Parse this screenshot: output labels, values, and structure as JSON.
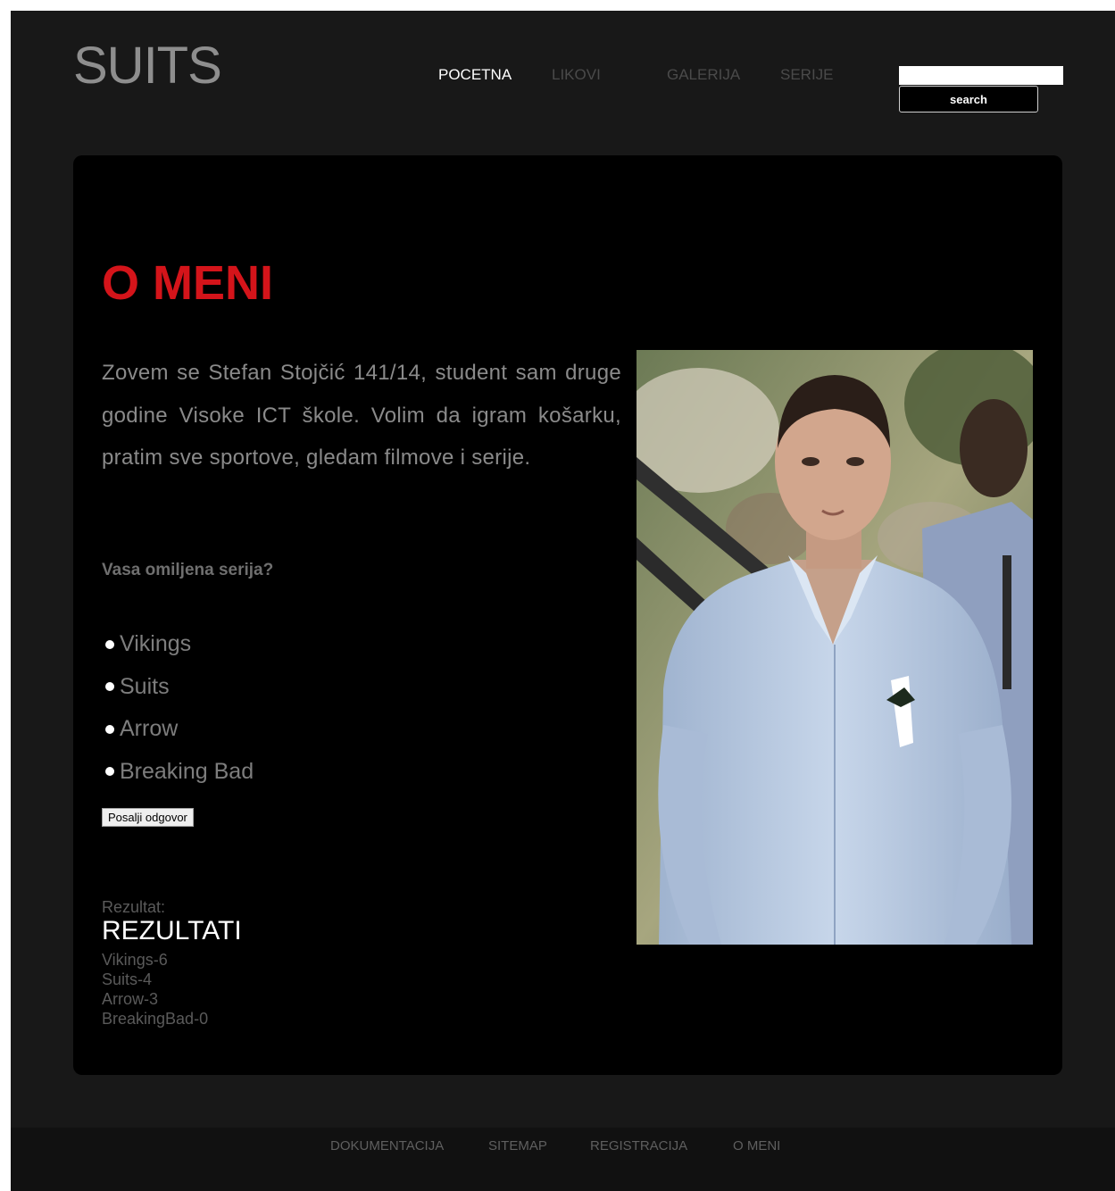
{
  "header": {
    "logo": "SUITS",
    "nav": [
      {
        "label": "POCETNA",
        "active": true
      },
      {
        "label": "LIKOVI",
        "active": false
      },
      {
        "label": "GALERIJA",
        "active": false
      },
      {
        "label": "SERIJE",
        "active": false
      }
    ],
    "search": {
      "value": "",
      "placeholder": "",
      "button_label": "search"
    }
  },
  "main": {
    "title": "O MENI",
    "bio": "Zovem se Stefan Stojčić 141/14, student sam druge godine Visoke ICT škole. Volim da igram košarku, pratim sve sportove, gledam filmove i serije.",
    "poll": {
      "question": "Vasa omiljena serija?",
      "options": [
        "Vikings",
        "Suits",
        "Arrow",
        "Breaking Bad"
      ],
      "submit_label": "Posalji odgovor"
    },
    "results": {
      "label": "Rezultat:",
      "title": "REZULTATI",
      "items": [
        "Vikings-6",
        "Suits-4",
        "Arrow-3",
        "BreakingBad-0"
      ]
    }
  },
  "footer": {
    "links": [
      "DOKUMENTACIJA",
      "SITEMAP",
      "REGISTRACIJA",
      "O MENI"
    ]
  },
  "colors": {
    "page_bg": "#181818",
    "panel_bg": "#000000",
    "title_red": "#d4141a",
    "nav_active": "#ffffff",
    "nav_inactive": "#4a4a4a"
  }
}
